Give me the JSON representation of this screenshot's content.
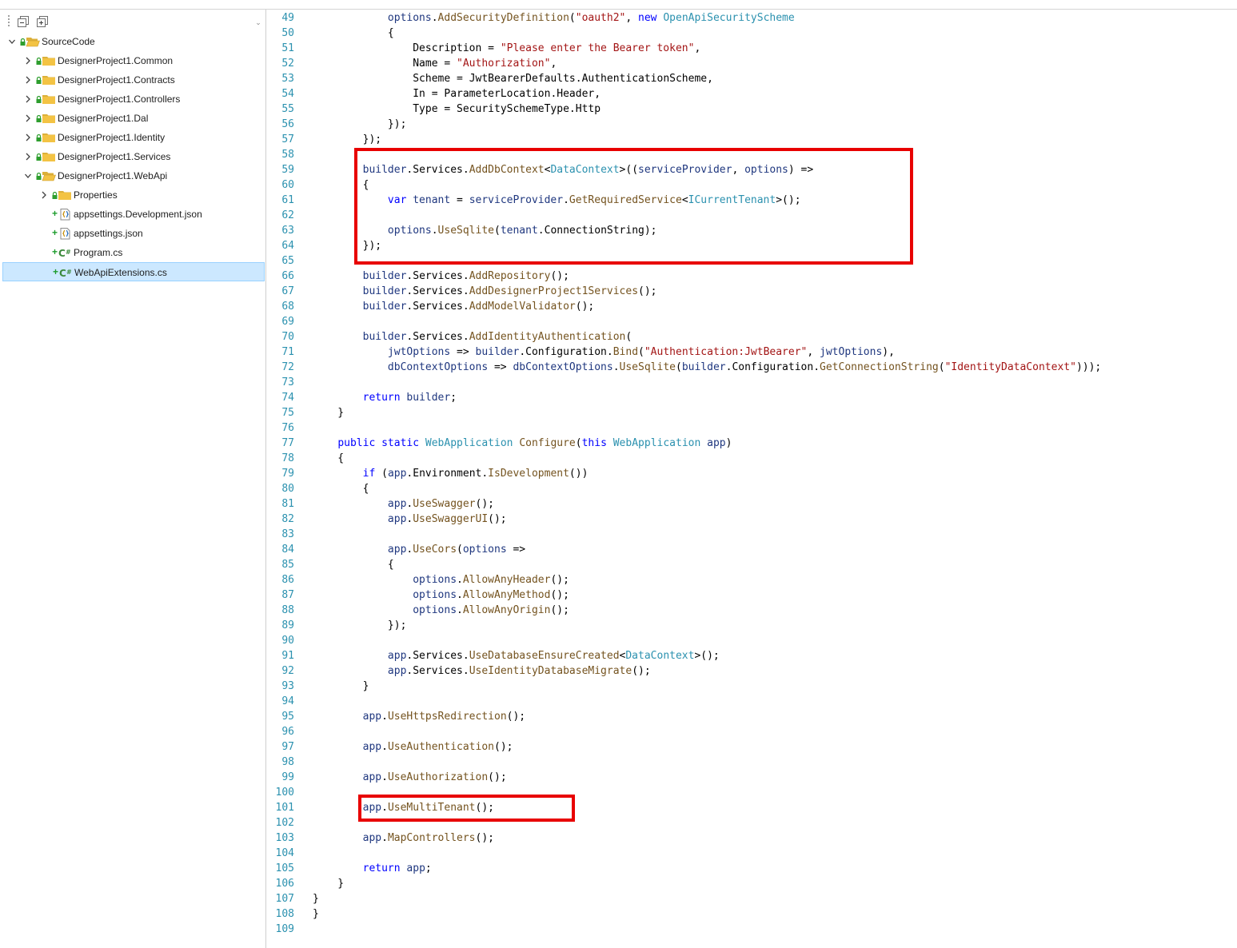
{
  "explorer": {
    "toolbar": {
      "collapse_all_icon": "collapse-all-icon",
      "show_all_icon": "show-all-files-icon",
      "overflow_icon": "chevron-down-icon"
    },
    "tree": [
      {
        "label": "SourceCode",
        "icon": "folder-open-icon",
        "expander": "expanded",
        "status": "lock"
      },
      {
        "label": "DesignerProject1.Common",
        "icon": "folder-icon",
        "expander": "collapsed",
        "status": "lock"
      },
      {
        "label": "DesignerProject1.Contracts",
        "icon": "folder-icon",
        "expander": "collapsed",
        "status": "lock"
      },
      {
        "label": "DesignerProject1.Controllers",
        "icon": "folder-icon",
        "expander": "collapsed",
        "status": "lock"
      },
      {
        "label": "DesignerProject1.Dal",
        "icon": "folder-icon",
        "expander": "collapsed",
        "status": "lock"
      },
      {
        "label": "DesignerProject1.Identity",
        "icon": "folder-icon",
        "expander": "collapsed",
        "status": "lock"
      },
      {
        "label": "DesignerProject1.Services",
        "icon": "folder-icon",
        "expander": "collapsed",
        "status": "lock"
      },
      {
        "label": "DesignerProject1.WebApi",
        "icon": "folder-open-icon",
        "expander": "expanded",
        "status": "lock"
      },
      {
        "label": "Properties",
        "icon": "folder-icon",
        "expander": "collapsed",
        "status": "lock"
      },
      {
        "label": "appsettings.Development.json",
        "icon": "json-file-icon",
        "expander": "none",
        "status": "added"
      },
      {
        "label": "appsettings.json",
        "icon": "json-file-icon",
        "expander": "none",
        "status": "added"
      },
      {
        "label": "Program.cs",
        "icon": "csharp-file-icon",
        "expander": "none",
        "status": "added"
      },
      {
        "label": "WebApiExtensions.cs",
        "icon": "csharp-file-icon",
        "expander": "none",
        "status": "added",
        "selected": true
      }
    ]
  },
  "editor": {
    "file": "WebApiExtensions.cs",
    "highlight_color": "#e80000",
    "lines": [
      {
        "n": "49",
        "text": "            options.AddSecurityDefinition(\"oauth2\", new OpenApiSecurityScheme"
      },
      {
        "n": "50",
        "text": "            {"
      },
      {
        "n": "51",
        "text": "                Description = \"Please enter the Bearer token\","
      },
      {
        "n": "52",
        "text": "                Name = \"Authorization\","
      },
      {
        "n": "53",
        "text": "                Scheme = JwtBearerDefaults.AuthenticationScheme,"
      },
      {
        "n": "54",
        "text": "                In = ParameterLocation.Header,"
      },
      {
        "n": "55",
        "text": "                Type = SecuritySchemeType.Http"
      },
      {
        "n": "56",
        "text": "            });"
      },
      {
        "n": "57",
        "text": "        });"
      },
      {
        "n": "58",
        "text": ""
      },
      {
        "n": "59",
        "text": "        builder.Services.AddDbContext<DataContext>((serviceProvider, options) =>"
      },
      {
        "n": "60",
        "text": "        {"
      },
      {
        "n": "61",
        "text": "            var tenant = serviceProvider.GetRequiredService<ICurrentTenant>();"
      },
      {
        "n": "62",
        "text": ""
      },
      {
        "n": "63",
        "text": "            options.UseSqlite(tenant.ConnectionString);"
      },
      {
        "n": "64",
        "text": "        });"
      },
      {
        "n": "65",
        "text": ""
      },
      {
        "n": "66",
        "text": "        builder.Services.AddRepository();"
      },
      {
        "n": "67",
        "text": "        builder.Services.AddDesignerProject1Services();"
      },
      {
        "n": "68",
        "text": "        builder.Services.AddModelValidator();"
      },
      {
        "n": "69",
        "text": ""
      },
      {
        "n": "70",
        "text": "        builder.Services.AddIdentityAuthentication("
      },
      {
        "n": "71",
        "text": "            jwtOptions => builder.Configuration.Bind(\"Authentication:JwtBearer\", jwtOptions),"
      },
      {
        "n": "72",
        "text": "            dbContextOptions => dbContextOptions.UseSqlite(builder.Configuration.GetConnectionString(\"IdentityDataContext\")));"
      },
      {
        "n": "73",
        "text": ""
      },
      {
        "n": "74",
        "text": "        return builder;"
      },
      {
        "n": "75",
        "text": "    }"
      },
      {
        "n": "76",
        "text": ""
      },
      {
        "n": "77",
        "text": "    public static WebApplication Configure(this WebApplication app)"
      },
      {
        "n": "78",
        "text": "    {"
      },
      {
        "n": "79",
        "text": "        if (app.Environment.IsDevelopment())"
      },
      {
        "n": "80",
        "text": "        {"
      },
      {
        "n": "81",
        "text": "            app.UseSwagger();"
      },
      {
        "n": "82",
        "text": "            app.UseSwaggerUI();"
      },
      {
        "n": "83",
        "text": ""
      },
      {
        "n": "84",
        "text": "            app.UseCors(options =>"
      },
      {
        "n": "85",
        "text": "            {"
      },
      {
        "n": "86",
        "text": "                options.AllowAnyHeader();"
      },
      {
        "n": "87",
        "text": "                options.AllowAnyMethod();"
      },
      {
        "n": "88",
        "text": "                options.AllowAnyOrigin();"
      },
      {
        "n": "89",
        "text": "            });"
      },
      {
        "n": "90",
        "text": ""
      },
      {
        "n": "91",
        "text": "            app.Services.UseDatabaseEnsureCreated<DataContext>();"
      },
      {
        "n": "92",
        "text": "            app.Services.UseIdentityDatabaseMigrate();"
      },
      {
        "n": "93",
        "text": "        }"
      },
      {
        "n": "94",
        "text": ""
      },
      {
        "n": "95",
        "text": "        app.UseHttpsRedirection();"
      },
      {
        "n": "96",
        "text": ""
      },
      {
        "n": "97",
        "text": "        app.UseAuthentication();"
      },
      {
        "n": "98",
        "text": ""
      },
      {
        "n": "99",
        "text": "        app.UseAuthorization();"
      },
      {
        "n": "100",
        "text": ""
      },
      {
        "n": "101",
        "text": "        app.UseMultiTenant();"
      },
      {
        "n": "102",
        "text": ""
      },
      {
        "n": "103",
        "text": "        app.MapControllers();"
      },
      {
        "n": "104",
        "text": ""
      },
      {
        "n": "105",
        "text": "        return app;"
      },
      {
        "n": "106",
        "text": "    }"
      },
      {
        "n": "107",
        "text": "}"
      },
      {
        "n": "108",
        "text": "}"
      },
      {
        "n": "109",
        "text": ""
      }
    ]
  }
}
